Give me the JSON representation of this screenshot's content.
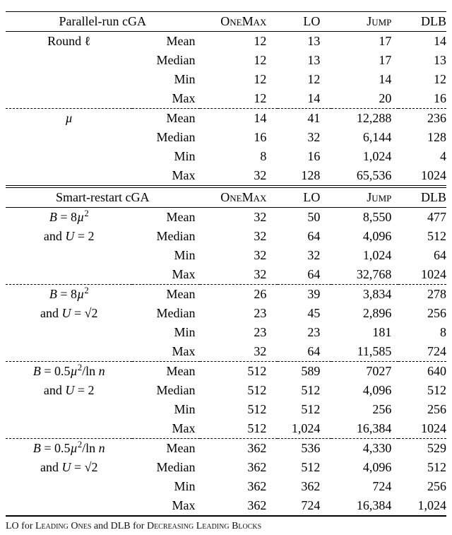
{
  "panels": [
    {
      "header": {
        "a": "Parallel-run cGA",
        "b": "",
        "c": "OneMax",
        "d": "LO",
        "e": "Jump",
        "f": "DLB"
      },
      "groups": [
        {
          "label": "Round ℓ",
          "label2": "",
          "rows": [
            {
              "s": "Mean",
              "v": [
                "12",
                "13",
                "17",
                "14"
              ]
            },
            {
              "s": "Median",
              "v": [
                "12",
                "13",
                "17",
                "13"
              ]
            },
            {
              "s": "Min",
              "v": [
                "12",
                "12",
                "14",
                "12"
              ]
            },
            {
              "s": "Max",
              "v": [
                "12",
                "14",
                "20",
                "16"
              ]
            }
          ]
        },
        {
          "label": "µ",
          "label2": "",
          "rows": [
            {
              "s": "Mean",
              "v": [
                "14",
                "41",
                "12,288",
                "236"
              ]
            },
            {
              "s": "Median",
              "v": [
                "16",
                "32",
                "6,144",
                "128"
              ]
            },
            {
              "s": "Min",
              "v": [
                "8",
                "16",
                "1,024",
                "4"
              ]
            },
            {
              "s": "Max",
              "v": [
                "32",
                "128",
                "65,536",
                "1024"
              ]
            }
          ]
        }
      ]
    },
    {
      "header": {
        "a": "Smart-restart cGA",
        "b": "",
        "c": "OneMax",
        "d": "LO",
        "e": "Jump",
        "f": "DLB"
      },
      "groups": [
        {
          "label": "B = 8µ²",
          "label2": "and U = 2",
          "rows": [
            {
              "s": "Mean",
              "v": [
                "32",
                "50",
                "8,550",
                "477"
              ]
            },
            {
              "s": "Median",
              "v": [
                "32",
                "64",
                "4,096",
                "512"
              ]
            },
            {
              "s": "Min",
              "v": [
                "32",
                "32",
                "1,024",
                "64"
              ]
            },
            {
              "s": "Max",
              "v": [
                "32",
                "64",
                "32,768",
                "1024"
              ]
            }
          ]
        },
        {
          "label": "B = 8µ²",
          "label2": "and U = √2",
          "rows": [
            {
              "s": "Mean",
              "v": [
                "26",
                "39",
                "3,834",
                "278"
              ]
            },
            {
              "s": "Median",
              "v": [
                "23",
                "45",
                "2,896",
                "256"
              ]
            },
            {
              "s": "Min",
              "v": [
                "23",
                "23",
                "181",
                "8"
              ]
            },
            {
              "s": "Max",
              "v": [
                "32",
                "64",
                "11,585",
                "724"
              ]
            }
          ]
        },
        {
          "label": "B = 0.5µ²/ln n",
          "label2": "and U = 2",
          "rows": [
            {
              "s": "Mean",
              "v": [
                "512",
                "589",
                "7027",
                "640"
              ]
            },
            {
              "s": "Median",
              "v": [
                "512",
                "512",
                "4,096",
                "512"
              ]
            },
            {
              "s": "Min",
              "v": [
                "512",
                "512",
                "256",
                "256"
              ]
            },
            {
              "s": "Max",
              "v": [
                "512",
                "1,024",
                "16,384",
                "1024"
              ]
            }
          ]
        },
        {
          "label": "B = 0.5µ²/ln n",
          "label2": "and U = √2",
          "rows": [
            {
              "s": "Mean",
              "v": [
                "362",
                "536",
                "4,330",
                "529"
              ]
            },
            {
              "s": "Median",
              "v": [
                "362",
                "512",
                "4,096",
                "512"
              ]
            },
            {
              "s": "Min",
              "v": [
                "362",
                "362",
                "724",
                "256"
              ]
            },
            {
              "s": "Max",
              "v": [
                "362",
                "724",
                "16,384",
                "1,024"
              ]
            }
          ]
        }
      ]
    }
  ],
  "footnote": "LO for Leading Ones and DLB for Decreasing Leading Blocks",
  "chart_data": {
    "type": "table",
    "title": "cGA statistics by benchmark",
    "columns": [
      "OneMax",
      "LO",
      "Jump",
      "DLB"
    ],
    "parallel_run": {
      "round_l": {
        "Mean": [
          12,
          13,
          17,
          14
        ],
        "Median": [
          12,
          13,
          17,
          13
        ],
        "Min": [
          12,
          12,
          14,
          12
        ],
        "Max": [
          12,
          14,
          20,
          16
        ]
      },
      "mu": {
        "Mean": [
          14,
          41,
          12288,
          236
        ],
        "Median": [
          16,
          32,
          6144,
          128
        ],
        "Min": [
          8,
          16,
          1024,
          4
        ],
        "Max": [
          32,
          128,
          65536,
          1024
        ]
      }
    },
    "smart_restart": {
      "B=8mu^2,U=2": {
        "Mean": [
          32,
          50,
          8550,
          477
        ],
        "Median": [
          32,
          64,
          4096,
          512
        ],
        "Min": [
          32,
          32,
          1024,
          64
        ],
        "Max": [
          32,
          64,
          32768,
          1024
        ]
      },
      "B=8mu^2,U=sqrt2": {
        "Mean": [
          26,
          39,
          3834,
          278
        ],
        "Median": [
          23,
          45,
          2896,
          256
        ],
        "Min": [
          23,
          23,
          181,
          8
        ],
        "Max": [
          32,
          64,
          11585,
          724
        ]
      },
      "B=0.5mu^2/ln n,U=2": {
        "Mean": [
          512,
          589,
          7027,
          640
        ],
        "Median": [
          512,
          512,
          4096,
          512
        ],
        "Min": [
          512,
          512,
          256,
          256
        ],
        "Max": [
          512,
          1024,
          16384,
          1024
        ]
      },
      "B=0.5mu^2/ln n,U=sqrt2": {
        "Mean": [
          362,
          536,
          4330,
          529
        ],
        "Median": [
          362,
          512,
          4096,
          512
        ],
        "Min": [
          362,
          362,
          724,
          256
        ],
        "Max": [
          362,
          724,
          16384,
          1024
        ]
      }
    }
  }
}
